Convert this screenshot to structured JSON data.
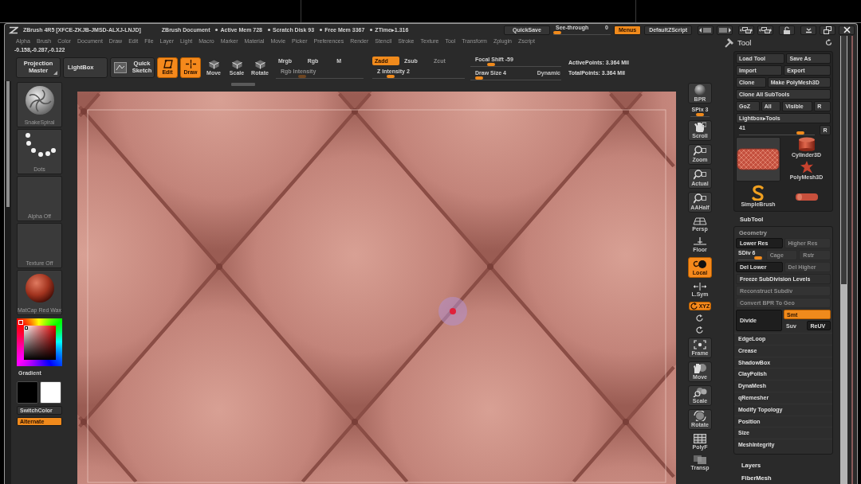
{
  "title_bar": {
    "app_title": "ZBrush 4R5 [XFCE-ZKJB-JMSD-ALXJ-LNJD]",
    "document": "ZBrush Document",
    "stats": [
      "Active Mem 728",
      "Scratch Disk 93",
      "Free Mem 3367",
      "ZTime▸1.316"
    ],
    "quicksave": "QuickSave",
    "see_through": {
      "label": "See-through",
      "value": "0",
      "level": 0
    },
    "menus": {
      "label": "Menus",
      "on": true
    },
    "script": "DefaultZScript"
  },
  "menu_bar": [
    "Alpha",
    "Brush",
    "Color",
    "Document",
    "Draw",
    "Edit",
    "File",
    "Layer",
    "Light",
    "Macro",
    "Marker",
    "Material",
    "Movie",
    "Picker",
    "Preferences",
    "Render",
    "Stencil",
    "Stroke",
    "Texture",
    "Tool",
    "Transform",
    "Zplugin",
    "Zscript"
  ],
  "coordinates": "-0.158,-0.287,-0.122",
  "toolbar": {
    "buttons": [
      {
        "kind": "menu",
        "label": "Projection Master",
        "on": false
      },
      {
        "kind": "plain",
        "label": "LightBox",
        "on": false
      },
      {
        "kind": "sketch",
        "label": "Quick Sketch",
        "on": false
      },
      {
        "kind": "square",
        "label": "Edit",
        "on": true
      },
      {
        "kind": "square",
        "label": "Draw",
        "on": true
      },
      {
        "kind": "square",
        "label": "Move",
        "on": false
      },
      {
        "kind": "square",
        "label": "Scale",
        "on": false
      },
      {
        "kind": "square",
        "label": "Rotate",
        "on": false
      }
    ],
    "color_modes": [
      {
        "label": "Mrgb",
        "on": false
      },
      {
        "label": "Rgb",
        "on": false
      },
      {
        "label": "M",
        "on": false
      }
    ],
    "rgb_intensity": {
      "label": "Rgb Intensity",
      "disabled": true,
      "level": 0.28
    },
    "z_modes": [
      {
        "label": "Zadd",
        "on": true,
        "disabled": false
      },
      {
        "label": "Zsub",
        "on": false,
        "disabled": false
      },
      {
        "label": "Zcut",
        "on": false,
        "disabled": true
      }
    ],
    "z_intensity": {
      "label": "Z Intensity 2",
      "level": 0.17
    },
    "focal_shift": {
      "label": "Focal Shift -59",
      "level": 0.2
    },
    "draw_size": {
      "label": "Draw Size 4",
      "level": 0.06
    },
    "dynamic": "Dynamic",
    "points": [
      "ActivePoints: 3.364 Mil",
      "TotalPoints: 3.364 Mil"
    ]
  },
  "left_shelf": {
    "tiles": [
      {
        "label": "SnakeSpiral"
      },
      {
        "label": "Dots"
      },
      {
        "label": "Alpha Off"
      },
      {
        "label": "Texture Off"
      },
      {
        "label": "MatCap Red Wax"
      }
    ],
    "gradient": "Gradient",
    "swatches": [
      {
        "color": "#000000"
      },
      {
        "color": "#ffffff"
      }
    ],
    "switch_color": "SwitchColor",
    "alternate": {
      "label": "Alternate",
      "on": true
    }
  },
  "right_shelf": {
    "bpr": {
      "label": "BPR"
    },
    "spix": {
      "label": "SPix 3",
      "level": 0.5
    },
    "buttons": [
      {
        "kind": "tile",
        "label": "Scroll",
        "on": false
      },
      {
        "kind": "tile",
        "label": "Zoom",
        "on": false
      },
      {
        "kind": "tile",
        "label": "Actual",
        "on": false
      },
      {
        "kind": "tile",
        "label": "AAHalf",
        "on": false
      },
      {
        "kind": "plain",
        "label": "Persp",
        "on": false
      },
      {
        "kind": "plain",
        "label": "Floor",
        "on": false
      },
      {
        "kind": "tile",
        "label": "Local",
        "on": true
      },
      {
        "kind": "plain",
        "label": "L.Sym",
        "on": false
      },
      {
        "kind": "pill",
        "label": "XYZ",
        "on": true
      },
      {
        "kind": "axis",
        "on": false
      },
      {
        "kind": "axis",
        "on": false
      },
      {
        "kind": "tile",
        "label": "Frame",
        "on": false
      },
      {
        "kind": "tile",
        "label": "Move",
        "on": false
      },
      {
        "kind": "tile",
        "label": "Scale",
        "on": false
      },
      {
        "kind": "tile",
        "label": "Rotate",
        "on": false
      },
      {
        "kind": "plain",
        "label": "PolyF",
        "on": false
      },
      {
        "kind": "plain",
        "label": "Transp",
        "on": false
      }
    ]
  },
  "tool_palette": {
    "title": "Tool",
    "button_rows": [
      [
        {
          "label": "Load Tool"
        },
        {
          "label": "Save As"
        }
      ],
      [
        {
          "label": "Import"
        },
        {
          "label": "Export"
        }
      ],
      [
        {
          "label": "Clone"
        },
        {
          "label": "Make PolyMesh3D"
        }
      ],
      [
        {
          "label": "Clone All SubTools"
        }
      ],
      [
        {
          "label": "GoZ"
        },
        {
          "label": "All"
        },
        {
          "label": "Visible"
        },
        {
          "label": "R"
        }
      ],
      [
        {
          "label": "Lightbox▸Tools"
        }
      ]
    ],
    "tool_slider": {
      "value": "41",
      "reset": "R",
      "level": 0.85
    },
    "tools": [
      {
        "kind": "tufted",
        "selected": true
      },
      {
        "kind": "cylinder",
        "label": "Cylinder3D",
        "selected": false
      },
      {
        "kind": "star",
        "label": "PolyMesh3D",
        "selected": false
      },
      {
        "kind": "brush",
        "label": "SimpleBrush",
        "selected": false
      },
      {
        "kind": "small_cylinder",
        "selected": false
      }
    ],
    "subtool": "SubTool",
    "geometry": {
      "title": "Geometry",
      "lines": [
        {
          "items": [
            {
              "kind": "button",
              "label": "Lower Res",
              "disabled": false
            },
            {
              "kind": "button",
              "label": "Higher Res",
              "disabled": true
            }
          ]
        },
        {
          "items": [
            {
              "kind": "slider",
              "label": "SDiv 6",
              "level": 1
            },
            {
              "kind": "button",
              "label": "Cage",
              "disabled": true
            },
            {
              "kind": "button",
              "label": "Rstr",
              "disabled": true
            }
          ]
        },
        {
          "items": [
            {
              "kind": "button",
              "label": "Del Lower",
              "disabled": false
            },
            {
              "kind": "button",
              "label": "Del Higher",
              "disabled": true
            }
          ]
        },
        {
          "items": [
            {
              "kind": "button",
              "label": "Freeze SubDivision Levels",
              "disabled": false
            }
          ]
        },
        {
          "items": [
            {
              "kind": "button",
              "label": "Reconstruct Subdiv",
              "disabled": true
            }
          ]
        },
        {
          "items": [
            {
              "kind": "button",
              "label": "Convert BPR To Geo",
              "disabled": true
            }
          ]
        }
      ],
      "divide": {
        "label": "Divide",
        "toggles": [
          {
            "label": "Smt",
            "on": true
          },
          {
            "label": "Suv",
            "on": false
          }
        ],
        "reuv": "ReUV"
      },
      "subsections": [
        "EdgeLoop",
        "Crease",
        "ShadowBox",
        "ClayPolish",
        "DynaMesh",
        "qRemesher",
        "Modify Topology",
        "Position",
        "Size",
        "MeshIntegrity"
      ]
    },
    "sections": [
      "Layers",
      "FiberMesh"
    ]
  }
}
